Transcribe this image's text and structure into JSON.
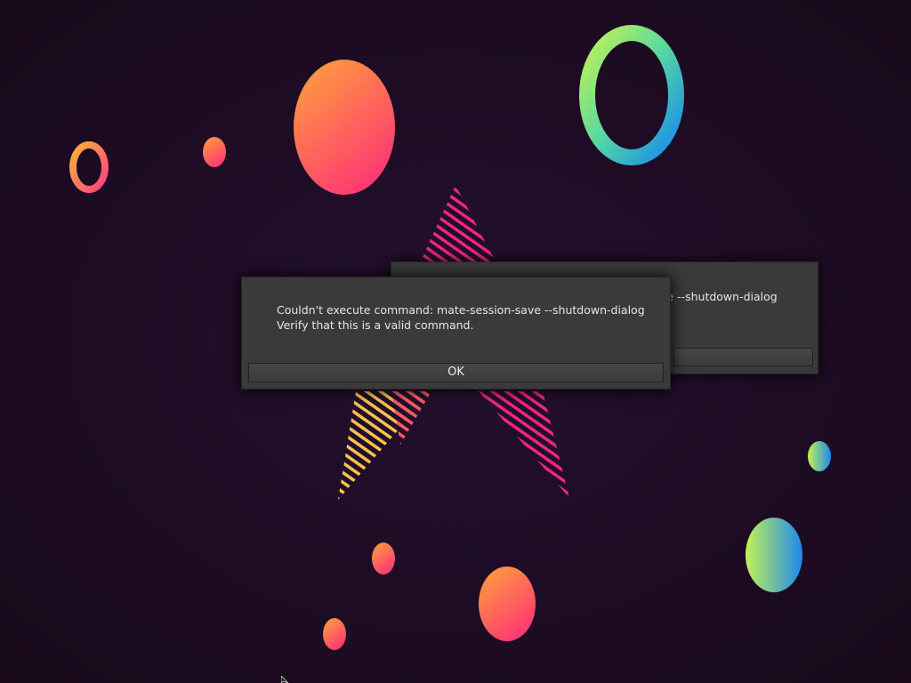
{
  "wallpaper": {
    "background_color": "#1e0c24",
    "palette": {
      "orange": "#ffa43a",
      "pink": "#ff2f7c",
      "yellow": "#ffe95a",
      "green": "#b8f15a",
      "blue": "#1e8df0"
    }
  },
  "background_dialog": {
    "visible_message": "ve --shutdown-dialog",
    "button_label": ""
  },
  "error_dialog": {
    "message_line1": "Couldn't execute command: mate-session-save --shutdown-dialog",
    "message_line2": "Verify that this is a valid command.",
    "ok_button": "OK"
  },
  "cursor": {
    "icon": "arrow-cursor-icon"
  }
}
